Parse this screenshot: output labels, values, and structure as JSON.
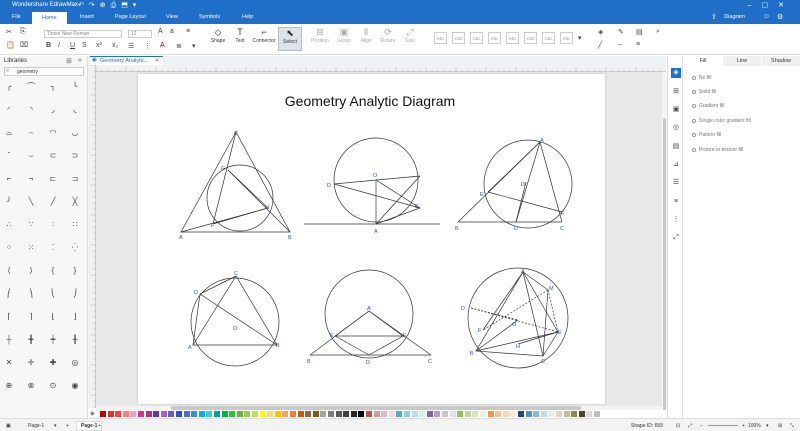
{
  "app": {
    "title": "Wondershare EdrawMax"
  },
  "menu_tabs": [
    "File",
    "Home",
    "Insert",
    "Page Layout",
    "View",
    "Symbols",
    "Help"
  ],
  "active_tab": "Home",
  "account": {
    "label": "Diagram"
  },
  "ribbon": {
    "font_name": "Times New Roman",
    "font_size": "12",
    "tools": [
      "Shape",
      "Text",
      "Connector",
      "Select"
    ],
    "arrange": [
      "Position",
      "Group",
      "Align",
      "Rotate",
      "Size"
    ],
    "style_label": "Abc"
  },
  "libraries": {
    "title": "Libraries",
    "search_value": "geometry"
  },
  "document": {
    "tab_name": "Geometry Analytic..."
  },
  "diagram": {
    "title": "Geometry Analytic Diagram",
    "labels": {
      "d1": [
        "C",
        "G",
        "H",
        "F",
        "A",
        "B"
      ],
      "d2": [
        "D",
        "O",
        "E",
        "A"
      ],
      "d3": [
        "A",
        "E",
        "D",
        "F",
        "B",
        "D",
        "C"
      ],
      "d4": [
        "C",
        "D",
        "O",
        "A",
        "B"
      ],
      "d5": [
        "A",
        "E",
        "F",
        "B",
        "D",
        "C"
      ],
      "d6": [
        "A",
        "M",
        "D",
        "O",
        "E",
        "F",
        "H",
        "B",
        "C"
      ]
    }
  },
  "fill_panel": {
    "tabs": [
      "Fill",
      "Line",
      "Shadow"
    ],
    "active_tab": "Fill",
    "options": [
      "No fill",
      "Solid fill",
      "Gradient fill",
      "Single color gradient fill",
      "Pattern fill",
      "Picture or texture fill"
    ]
  },
  "status": {
    "page_nav": "Page-1",
    "page_tab": "Page-1",
    "shape_id": "Shape ID: 659",
    "zoom": "100%"
  },
  "palette_colors": [
    "#c00000",
    "#e03030",
    "#ff4040",
    "#ff7f7f",
    "#ff99cc",
    "#e0308a",
    "#b03090",
    "#7030a0",
    "#9966cc",
    "#6a5acd",
    "#3050d0",
    "#4472c4",
    "#2e8fd6",
    "#00b0f0",
    "#40c8e0",
    "#00a0a0",
    "#00b050",
    "#30c030",
    "#70ad47",
    "#92d050",
    "#b8e060",
    "#ffff00",
    "#ffd966",
    "#ffc000",
    "#f4a460",
    "#ed7d31",
    "#c55a11",
    "#996633",
    "#7f6000",
    "#a5a5a5",
    "#7f7f7f",
    "#595959",
    "#404040",
    "#262626",
    "#000000",
    "#c0504d",
    "#d99694",
    "#e6b8b7",
    "#f2dcdb",
    "#4bacc6",
    "#92cddc",
    "#b7dee8",
    "#dbeef3",
    "#8064a2",
    "#b2a1c7",
    "#ccc0da",
    "#e4dfec",
    "#9bbb59",
    "#c3d69b",
    "#d7e4bc",
    "#ebf1de",
    "#f79646",
    "#fac08f",
    "#fcd5b4",
    "#fde9d9",
    "#1f497d",
    "#558ed5",
    "#8db3e2",
    "#c6d9f0",
    "#eeece1",
    "#ddd9c3",
    "#c4bd97",
    "#938953",
    "#494429",
    "#d9d9d9",
    "#bfbfbf"
  ]
}
